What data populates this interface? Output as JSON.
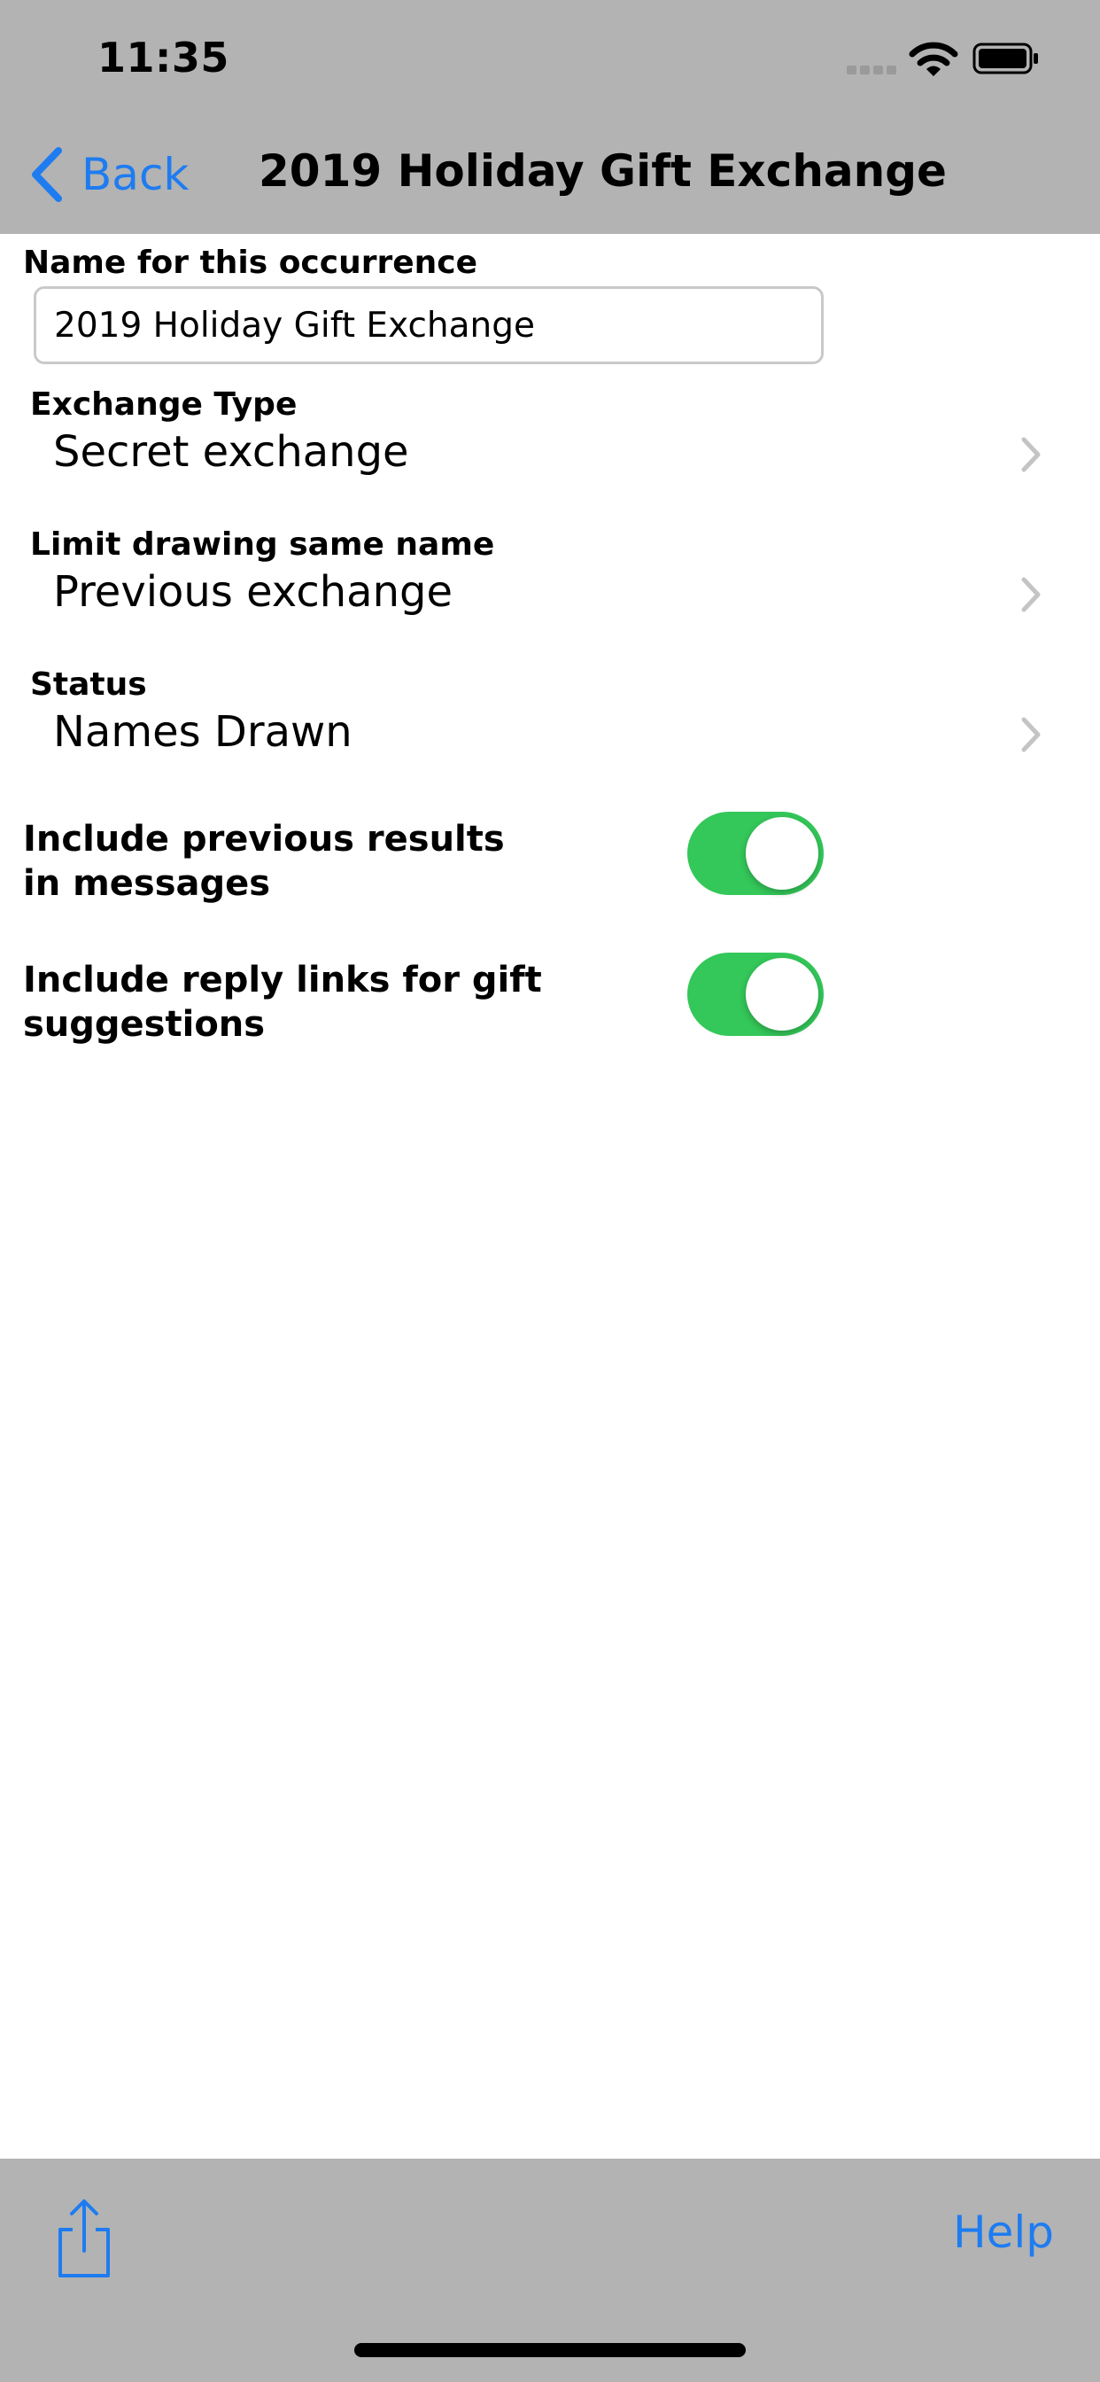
{
  "status_bar": {
    "time": "11:35"
  },
  "nav": {
    "back_label": "Back",
    "title": "2019 Holiday Gift Exchange"
  },
  "form": {
    "name": {
      "label": "Name for this occurrence",
      "value": "2019 Holiday Gift Exchange"
    },
    "exchange_type": {
      "label": "Exchange Type",
      "value": "Secret exchange"
    },
    "limit_drawing": {
      "label": "Limit drawing same name",
      "value": "Previous exchange"
    },
    "status": {
      "label": "Status",
      "value": "Names Drawn"
    },
    "include_previous": {
      "label": "Include previous results\nin messages",
      "on": true
    },
    "include_reply_links": {
      "label": "Include reply links for gift\nsuggestions",
      "on": true
    }
  },
  "toolbar": {
    "help_label": "Help",
    "share_icon": "share-icon"
  },
  "colors": {
    "accent": "#1e7cf0",
    "toggle_on": "#34c759",
    "bar_background": "#b3b3b3"
  }
}
